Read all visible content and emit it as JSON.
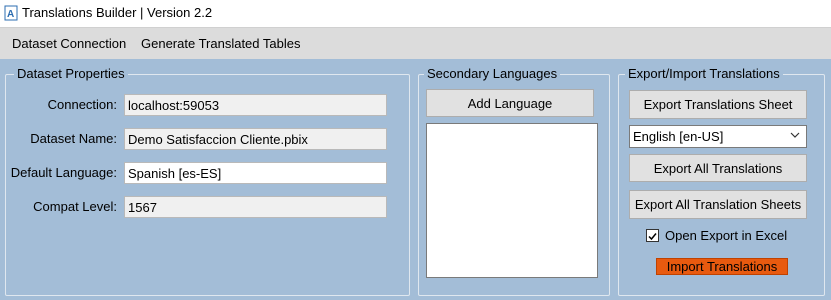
{
  "window": {
    "title": "Translations Builder | Version 2.2"
  },
  "menu": {
    "items": [
      "Dataset Connection",
      "Generate Translated Tables"
    ]
  },
  "dataset_properties": {
    "group_title": "Dataset Properties",
    "connection_label": "Connection:",
    "connection_value": "localhost:59053",
    "dataset_name_label": "Dataset Name:",
    "dataset_name_value": "Demo Satisfaccion Cliente.pbix",
    "default_language_label": "Default Language:",
    "default_language_value": "Spanish [es-ES]",
    "compat_level_label": "Compat Level:",
    "compat_level_value": "1567"
  },
  "secondary_languages": {
    "group_title": "Secondary Languages",
    "add_button": "Add Language",
    "items": []
  },
  "export_import": {
    "group_title": "Export/Import Translations",
    "export_sheet_button": "Export Translations Sheet",
    "language_select_value": "English [en-US]",
    "export_all_button": "Export All Translations",
    "export_all_sheets_button": "Export All Translation Sheets",
    "open_in_excel_label": "Open Export in Excel",
    "open_in_excel_checked": true,
    "import_button": "Import Translations"
  },
  "colors": {
    "panel_background": "#a3bdd7",
    "menubar_background": "#dcdcdc",
    "import_button": "#e85a0f"
  }
}
